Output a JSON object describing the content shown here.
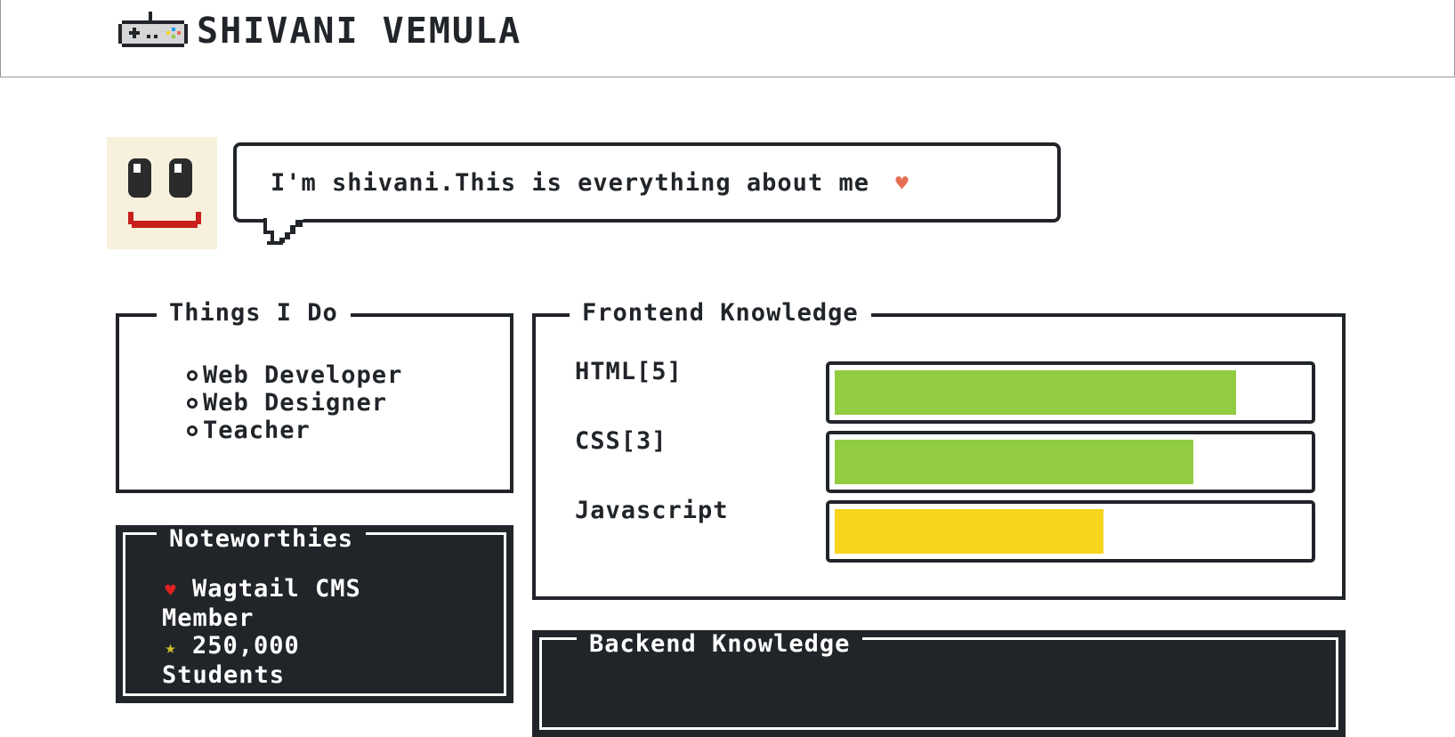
{
  "header": {
    "title": "SHIVANI VEMULA",
    "logo_icon": "game-controller-icon"
  },
  "intro": {
    "avatar_icon": "smiley-face-icon",
    "message": "I'm shivani.This is everything about me",
    "heart_icon": "heart-icon"
  },
  "things": {
    "title": "Things I Do",
    "items": [
      "Web Developer",
      "Web Designer",
      "Teacher"
    ]
  },
  "noteworthies": {
    "title": "Noteworthies",
    "items": [
      {
        "icon": "heart-icon",
        "glyph": "♥",
        "color": "#e02020",
        "line1": "Wagtail CMS",
        "line2": "Member"
      },
      {
        "icon": "star-icon",
        "glyph": "★",
        "color": "#d4c22a",
        "line1": "250,000",
        "line2": "Students"
      }
    ]
  },
  "frontend": {
    "title": "Frontend Knowledge",
    "skills": [
      {
        "label": "HTML[5]",
        "level": 0.85,
        "color": "#92cc41"
      },
      {
        "label": "CSS[3]",
        "level": 0.76,
        "color": "#92cc41"
      },
      {
        "label": "Javascript",
        "level": 0.57,
        "color": "#f7d51d"
      }
    ]
  },
  "backend": {
    "title": "Backend Knowledge"
  },
  "colors": {
    "text": "#212529",
    "success": "#92cc41",
    "warning": "#f7d51d",
    "avatar_bg": "#f7f0dc",
    "smile": "#c8201c"
  }
}
